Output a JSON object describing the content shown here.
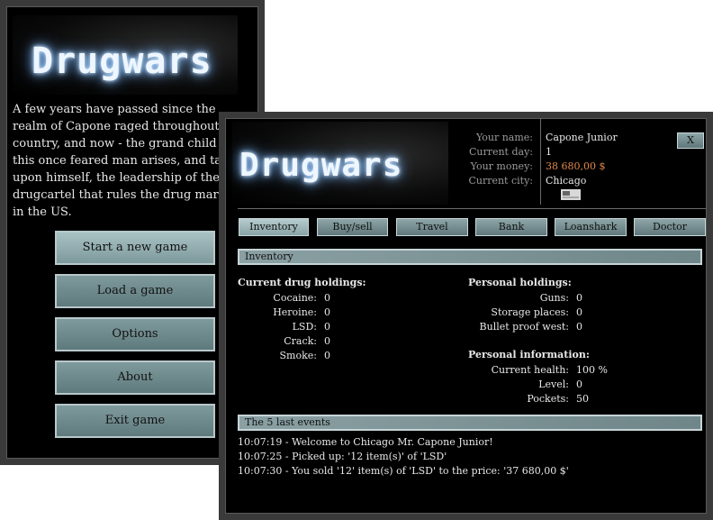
{
  "menu": {
    "logo": "Drugwars",
    "intro_lines": [
      "A few years have passed since the",
      "realm of Capone raged throughout t",
      "country, and now - the grand child o",
      "this once feared man arises, and ta",
      "upon himself, the leadership of the",
      "drugcartel that rules the drug mark",
      "in the US."
    ],
    "buttons": [
      "Start a new game",
      "Load a game",
      "Options",
      "About",
      "Exit game"
    ]
  },
  "game": {
    "logo": "Drugwars",
    "info": {
      "name_label": "Your name:",
      "name": "Capone Junior",
      "day_label": "Current day:",
      "day": "1",
      "money_label": "Your money:",
      "money": "38 680,00 $",
      "city_label": "Current city:",
      "city": "Chicago"
    },
    "close": "X",
    "tabs": [
      "Inventory",
      "Buy/sell",
      "Travel",
      "Bank",
      "Loanshark",
      "Doctor"
    ],
    "active_tab": "Inventory",
    "section_title": "Inventory",
    "drugs_heading": "Current drug holdings:",
    "drugs": [
      {
        "label": "Cocaine:",
        "value": "0"
      },
      {
        "label": "Heroine:",
        "value": "0"
      },
      {
        "label": "LSD:",
        "value": "0"
      },
      {
        "label": "Crack:",
        "value": "0"
      },
      {
        "label": "Smoke:",
        "value": "0"
      }
    ],
    "personal_heading": "Personal holdings:",
    "personal": [
      {
        "label": "Guns:",
        "value": "0"
      },
      {
        "label": "Storage places:",
        "value": "0"
      },
      {
        "label": "Bullet proof west:",
        "value": "0"
      }
    ],
    "info_heading": "Personal information:",
    "personal_info": [
      {
        "label": "Current health:",
        "value": "100 %"
      },
      {
        "label": "Level:",
        "value": "0"
      },
      {
        "label": "Pockets:",
        "value": "50"
      }
    ],
    "events_title": "The 5 last events",
    "events": [
      "10:07:19 - Welcome to Chicago Mr. Capone Junior!",
      "10:07:25 - Picked up: '12 item(s)' of 'LSD'",
      "10:07:30 - You sold '12' item(s) of 'LSD' to the price: '37 680,00 $'"
    ]
  }
}
